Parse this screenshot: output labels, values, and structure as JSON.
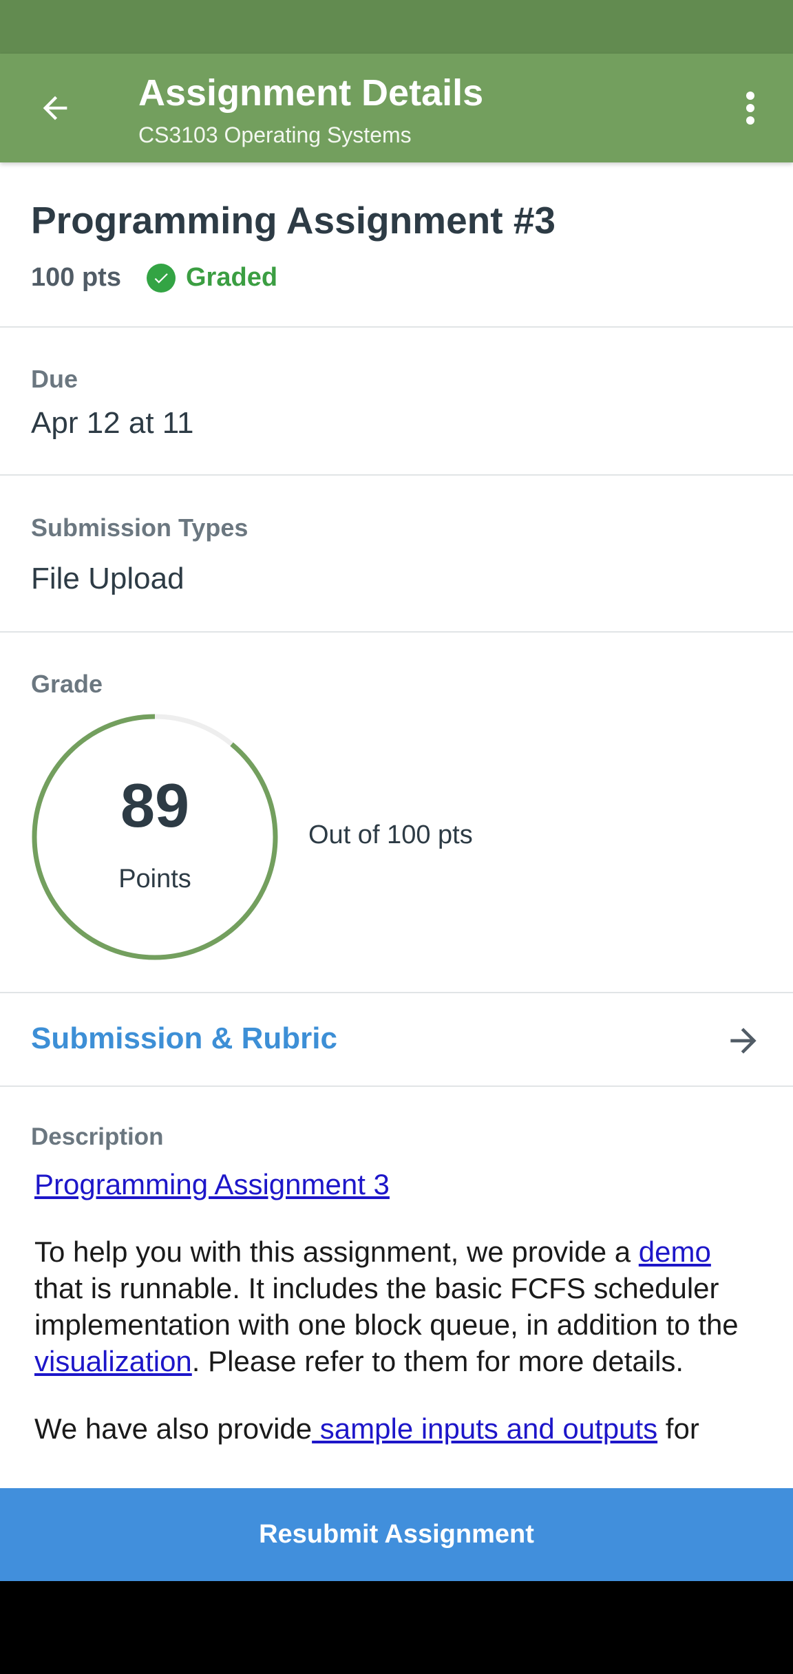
{
  "colors": {
    "status_bar": "#628b50",
    "toolbar": "#739f5e",
    "graded": "#3b9e42",
    "link": "#3d8fd6",
    "button": "#418fdc",
    "ring": "#739f5e"
  },
  "toolbar": {
    "back_icon": "arrow-left-icon",
    "title": "Assignment Details",
    "subtitle": "CS3103 Operating Systems",
    "menu_icon": "more-vert-icon"
  },
  "assignment": {
    "title": "Programming Assignment #3",
    "points": "100 pts",
    "status_icon": "check-circle-icon",
    "status": "Graded"
  },
  "due": {
    "label": "Due",
    "value": "Apr 12 at 11"
  },
  "submission_types": {
    "label": "Submission Types",
    "value": "File Upload"
  },
  "grade": {
    "label": "Grade",
    "score": "89",
    "score_label": "Points",
    "out_of": "Out of 100 pts",
    "fraction": 0.89
  },
  "rubric_link": {
    "label": "Submission & Rubric",
    "icon": "arrow-right-icon"
  },
  "description": {
    "label": "Description",
    "link_title": "Programming Assignment 3",
    "p1_pre": "To help you with this assignment, we provide a ",
    "p1_link1": "demo",
    "p1_mid": " that is runnable. It includes the basic FCFS scheduler implementation with one block queue, in addition to the ",
    "p1_link2": "visualization",
    "p1_post": ". Please refer to them for more details.",
    "p2_pre": "We have also provide",
    "p2_link": " sample inputs and outputs",
    "p2_post": " for"
  },
  "footer": {
    "resubmit_label": "Resubmit Assignment"
  }
}
